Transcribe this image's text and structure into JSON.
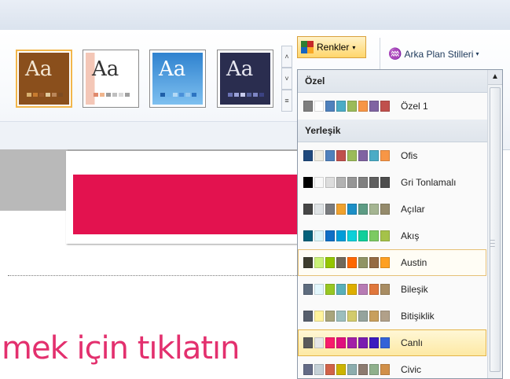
{
  "ribbon": {
    "themes": [
      {
        "name": "theme-brown",
        "aa": "Aa",
        "bg": "#8a4f1c",
        "fg": "#f3e6d2",
        "sw": [
          "#d8b070",
          "#c87b2f",
          "#9a5b2c",
          "#e0c89b",
          "#b9865a",
          "#7d4b22"
        ]
      },
      {
        "name": "theme-peach",
        "aa": "Aa",
        "bg": "#ffffff",
        "fg": "#333333",
        "sw": [
          "#e08a6d",
          "#f1b68d",
          "#9c9c9c",
          "#bfbfbf",
          "#d9d9d9",
          "#a0a0a0"
        ]
      },
      {
        "name": "theme-blue",
        "aa": "Aa",
        "bg": "#3c8fd6",
        "fg": "#ffffff",
        "sw": [
          "#1f5fa8",
          "#69b2ea",
          "#b3d9f5",
          "#4a90d9",
          "#95c7ef",
          "#2c74c1"
        ]
      },
      {
        "name": "theme-navy",
        "aa": "Aa",
        "bg": "#2a2d4f",
        "fg": "#e6e6f0",
        "sw": [
          "#6c73b5",
          "#9ba2d8",
          "#c8ccec",
          "#5964a0",
          "#7e86c4",
          "#3b4282"
        ]
      }
    ],
    "renkler_label": "Renkler",
    "arka_label": "Arka Plan Stilleri"
  },
  "slide": {
    "text": "mek için tıklatın"
  },
  "menu": {
    "sections": [
      {
        "title": "Özel",
        "items": [
          {
            "label": "Özel 1",
            "colors": [
              "#7f7f7f",
              "#ffffff",
              "#4f81bd",
              "#4bacc6",
              "#9bbb59",
              "#f79646",
              "#8064a2",
              "#c0504d"
            ]
          }
        ]
      },
      {
        "title": "Yerleşik",
        "items": [
          {
            "label": "Ofis",
            "colors": [
              "#1f497d",
              "#eeece1",
              "#4f81bd",
              "#c0504d",
              "#9bbb59",
              "#8064a2",
              "#4bacc6",
              "#f79646"
            ]
          },
          {
            "label": "Gri Tonlamalı",
            "colors": [
              "#000000",
              "#f8f8f8",
              "#dddddd",
              "#b2b2b2",
              "#969696",
              "#808080",
              "#5f5f5f",
              "#4d4d4d"
            ]
          },
          {
            "label": "Açılar",
            "colors": [
              "#464646",
              "#dfe3e5",
              "#797b7e",
              "#f0a22e",
              "#1c8fc6",
              "#5d9c84",
              "#a5b592",
              "#958b6c"
            ]
          },
          {
            "label": "Akış",
            "colors": [
              "#04617b",
              "#dbf5f9",
              "#0f6fc6",
              "#009dd9",
              "#0bd0d9",
              "#10cf9b",
              "#7cca62",
              "#a5c249"
            ]
          },
          {
            "label": "Austin",
            "colors": [
              "#3e3d2d",
              "#caf278",
              "#94c600",
              "#71685a",
              "#ff6700",
              "#909465",
              "#956b43",
              "#fea022"
            ]
          },
          {
            "label": "Bileşik",
            "colors": [
              "#5e6c7e",
              "#e3f7fd",
              "#98c723",
              "#59b0b9",
              "#deae00",
              "#b77bb4",
              "#e0773c",
              "#a98d63"
            ]
          },
          {
            "label": "Bitişiklik",
            "colors": [
              "#575f6d",
              "#fff39d",
              "#a9a57c",
              "#9cbebd",
              "#d2cb6c",
              "#95a39d",
              "#c89f5d",
              "#b1a089"
            ]
          },
          {
            "label": "Canlı",
            "colors": [
              "#5a5a5a",
              "#e6e6e6",
              "#f81b6c",
              "#e0107d",
              "#a21fa7",
              "#7a1db0",
              "#3a1bbf",
              "#3363d8"
            ]
          },
          {
            "label": "Civic",
            "colors": [
              "#646b86",
              "#c5d1d7",
              "#d16349",
              "#ccb400",
              "#8cadae",
              "#8c7b70",
              "#8fb08c",
              "#d19049"
            ]
          }
        ]
      }
    ],
    "selected": "Canlı",
    "boxed": "Austin"
  }
}
